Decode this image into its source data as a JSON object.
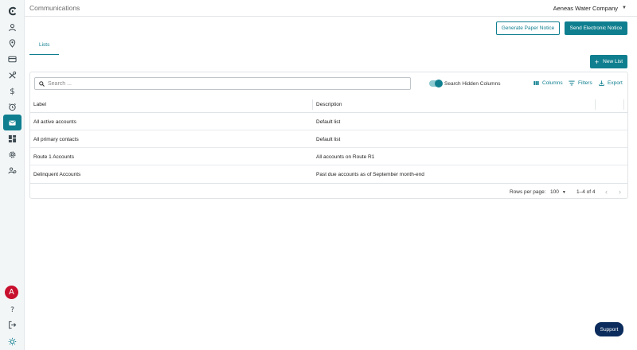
{
  "colors": {
    "accent": "#0f7f8f",
    "avatar": "#c8102e",
    "support": "#0b2c5c"
  },
  "header": {
    "title": "Communications",
    "company": "Aeneas Water Company"
  },
  "actions": {
    "paper_notice": "Generate Paper Notice",
    "electronic_notice": "Send Electronic Notice",
    "new_list": "New List"
  },
  "tabs": [
    {
      "label": "Lists",
      "active": true
    }
  ],
  "user": {
    "avatar_initial": "A"
  },
  "grid": {
    "search_placeholder": "Search ...",
    "toggle_label": "Search Hidden Columns",
    "toggle_on": true,
    "tools": {
      "columns": "Columns",
      "filters": "Filters",
      "export": "Export"
    },
    "columns": [
      "Label",
      "Description"
    ],
    "rows": [
      {
        "label": "All active accounts",
        "description": "Default list"
      },
      {
        "label": "All primary contacts",
        "description": "Default list"
      },
      {
        "label": "Route 1 Accounts",
        "description": "All accounts on Route R1"
      },
      {
        "label": "Delinquent Accounts",
        "description": "Past due accounts as of September month-end"
      }
    ],
    "footer": {
      "rows_per_page_label": "Rows per page:",
      "rows_per_page": "100",
      "range": "1–4 of 4"
    }
  },
  "support": {
    "label": "Support"
  },
  "sidebar_icons": [
    "logo-icon",
    "user-icon",
    "location-pin-icon",
    "credit-card-icon",
    "tools-icon",
    "dollar-icon",
    "alarm-clock-icon",
    "mail-icon",
    "dashboard-icon",
    "gear-icon",
    "users-admin-icon",
    "help-icon",
    "logout-icon",
    "brightness-icon"
  ]
}
